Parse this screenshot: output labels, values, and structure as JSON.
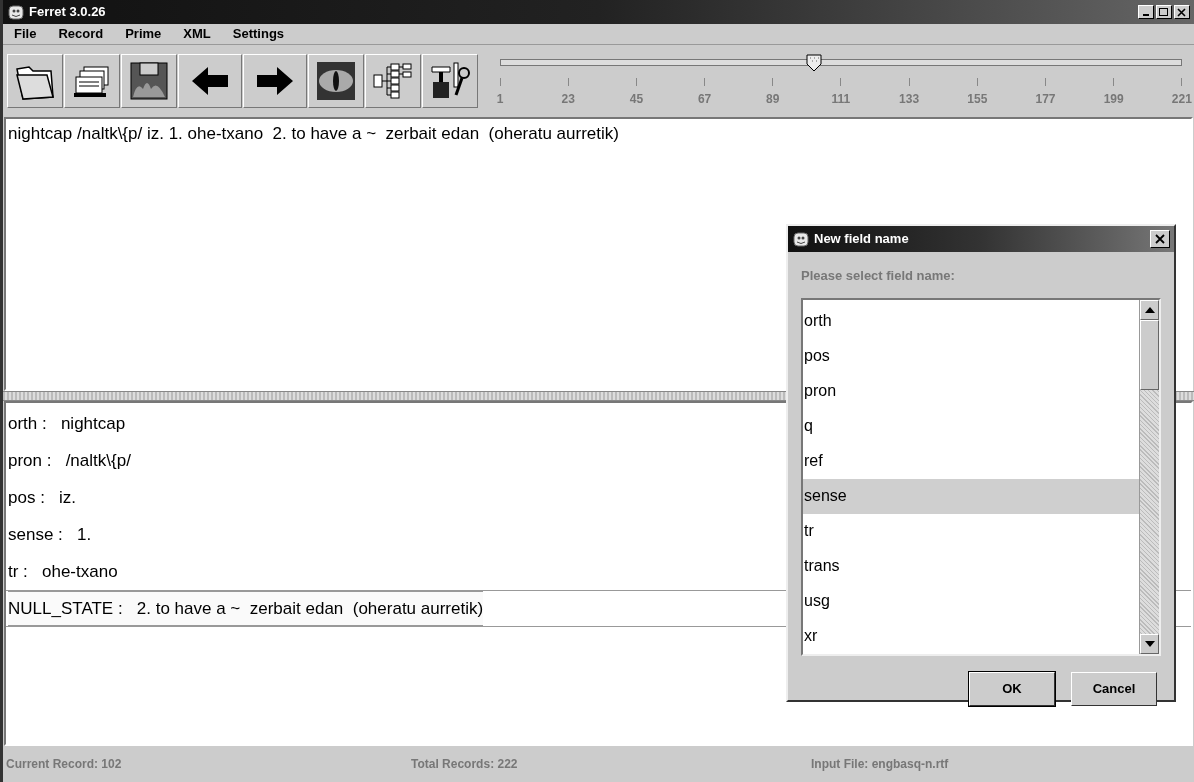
{
  "window": {
    "title": "Ferret 3.0.26"
  },
  "menu": [
    "File",
    "Record",
    "Prime",
    "XML",
    "Settings"
  ],
  "toolbar": [
    {
      "kind": "folder"
    },
    {
      "kind": "cards"
    },
    {
      "kind": "floppy"
    },
    {
      "kind": "back"
    },
    {
      "kind": "forward"
    },
    {
      "kind": "eye"
    },
    {
      "kind": "tree"
    },
    {
      "kind": "tools"
    }
  ],
  "record_slider": {
    "level": 0.46,
    "ticks": [
      "1",
      "23",
      "45",
      "67",
      "89",
      "111",
      "133",
      "155",
      "177",
      "199",
      "221"
    ]
  },
  "entry_text": "nightcap /naltk\\{p/ iz. 1. ohe-txano  2. to have a ~  zerbait edan  (oheratu aurretik)",
  "fields": [
    {
      "label": "orth :",
      "value": "nightcap",
      "selected": false
    },
    {
      "label": "pron :",
      "value": "/naltk\\{p/",
      "selected": false
    },
    {
      "label": "pos :",
      "value": "iz.",
      "selected": false
    },
    {
      "label": "sense :",
      "value": "1.",
      "selected": false
    },
    {
      "label": "tr :",
      "value": "ohe-txano",
      "selected": false
    },
    {
      "label": "NULL_STATE :",
      "value": "2. to have a ~  zerbait edan  (oheratu aurretik)",
      "selected": true
    }
  ],
  "status_bar": [
    "Current Record: 102",
    "Total Records: 222",
    "Input File: engbasq-n.rtf"
  ],
  "dialog": {
    "title": "New field name",
    "prompt": "Please select field name:",
    "options": [
      {
        "label": "orth",
        "selected": false
      },
      {
        "label": "pos",
        "selected": false
      },
      {
        "label": "pron",
        "selected": false
      },
      {
        "label": "q",
        "selected": false
      },
      {
        "label": "ref",
        "selected": false
      },
      {
        "label": "sense",
        "selected": true
      },
      {
        "label": "tr",
        "selected": false
      },
      {
        "label": "trans",
        "selected": false
      },
      {
        "label": "usg",
        "selected": false
      },
      {
        "label": "xr",
        "selected": false
      }
    ],
    "buttons": [
      "OK",
      "Cancel"
    ]
  }
}
